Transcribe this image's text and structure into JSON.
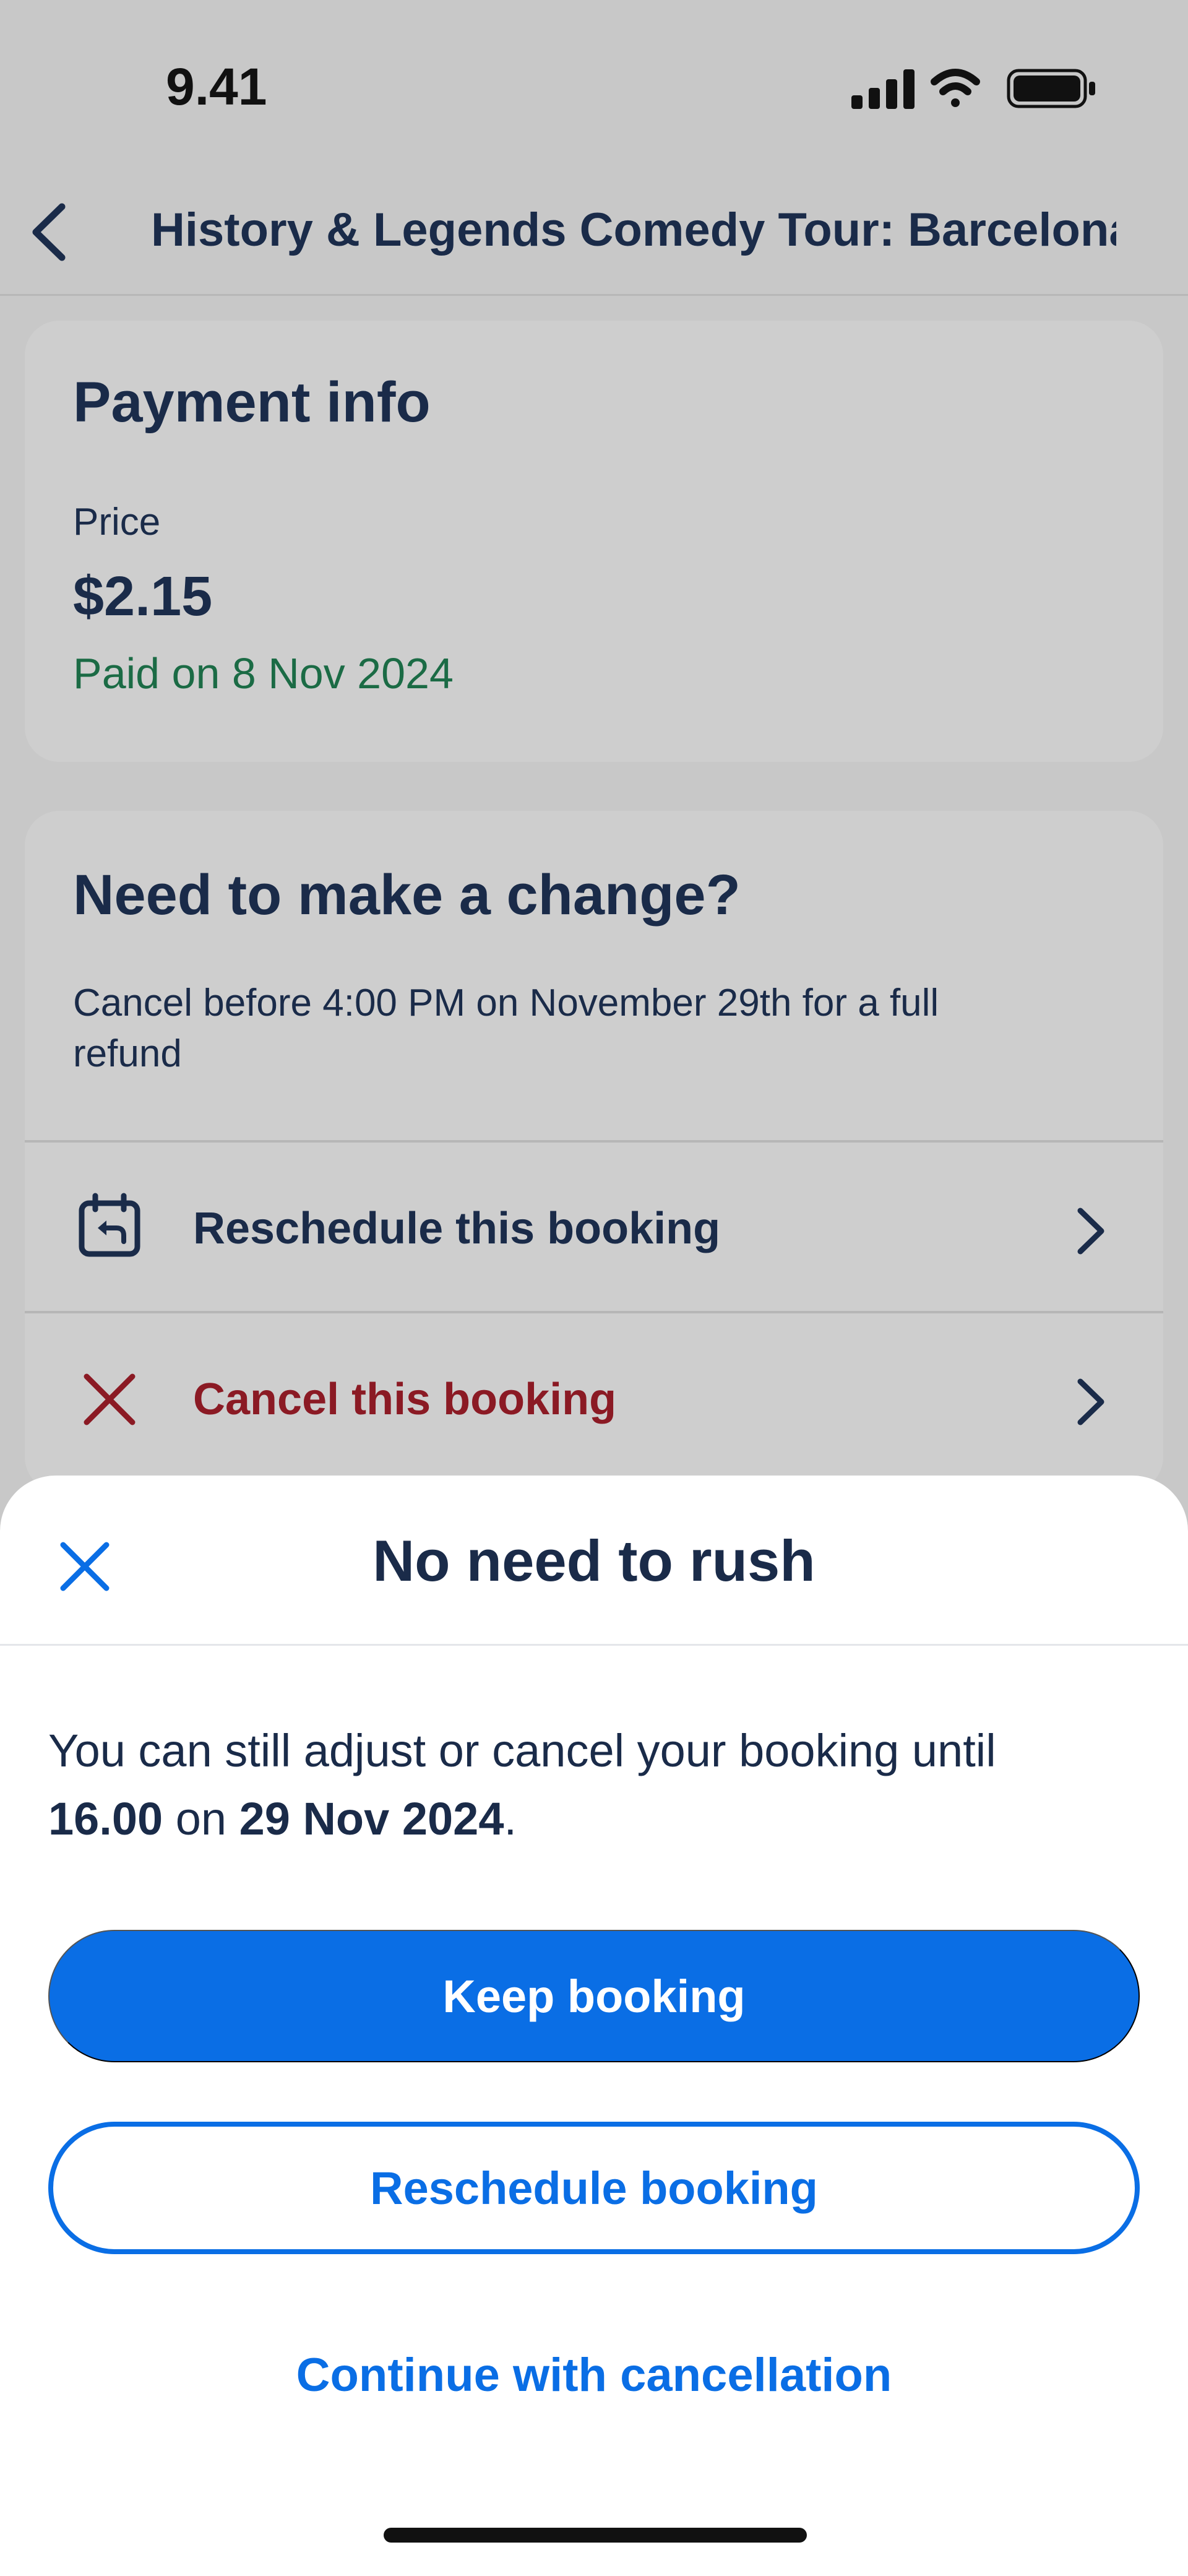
{
  "status_bar": {
    "time": "9.41"
  },
  "header": {
    "title": "History & Legends Comedy Tour: Barcelona..."
  },
  "payment_card": {
    "heading": "Payment info",
    "price_label": "Price",
    "price_value": "$2.15",
    "paid_on": "Paid on 8 Nov 2024",
    "paid_color": "#1b6b45"
  },
  "change_card": {
    "heading": "Need to make a change?",
    "description": "Cancel before 4:00 PM on November 29th for a full refund",
    "reschedule_label": "Reschedule this booking",
    "cancel_label": "Cancel this booking",
    "cancel_color": "#8b1a24"
  },
  "sheet": {
    "title": "No need to rush",
    "message_prefix": "You can still adjust or cancel your booking until ",
    "message_time": "16.00",
    "message_mid": " on ",
    "message_date": "29 Nov 2024",
    "message_suffix": ".",
    "keep_button": "Keep booking",
    "reschedule_button": "Reschedule booking",
    "continue_link": "Continue with cancellation",
    "accent_color": "#0a6ee5"
  },
  "icons": {
    "back": "chevron-left-icon",
    "reschedule": "calendar-reschedule-icon",
    "cancel": "x-icon",
    "chevron": "chevron-right-icon",
    "close": "close-icon"
  }
}
